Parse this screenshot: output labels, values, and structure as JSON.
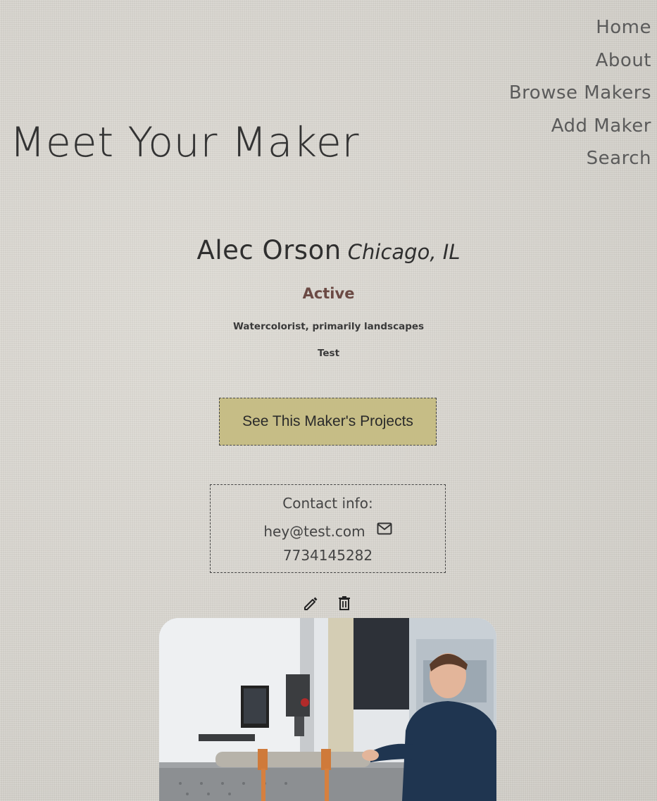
{
  "site": {
    "title": "Meet Your Maker"
  },
  "nav": {
    "items": [
      {
        "label": "Home"
      },
      {
        "label": "About"
      },
      {
        "label": "Browse Makers"
      },
      {
        "label": "Add Maker"
      },
      {
        "label": "Search"
      }
    ]
  },
  "maker": {
    "name": "Alec Orson",
    "location": "Chicago, IL",
    "status": "Active",
    "bio": "Watercolorist, primarily landscapes",
    "note": "Test",
    "projects_button": "See This Maker's Projects",
    "contact": {
      "label": "Contact info:",
      "email": "hey@test.com",
      "phone": "7734145282"
    }
  },
  "icons": {
    "mail": "mail-icon",
    "edit": "pencil-icon",
    "delete": "trash-icon"
  },
  "colors": {
    "button_bg": "#c6bd86",
    "status": "#6b4a44"
  }
}
